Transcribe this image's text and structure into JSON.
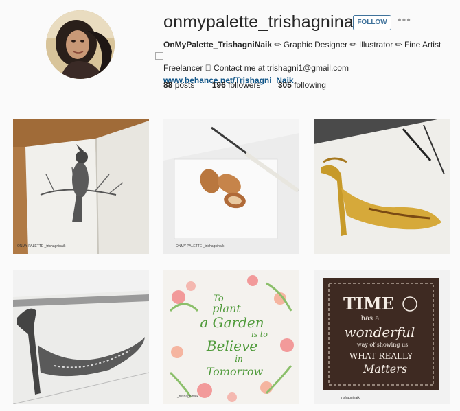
{
  "profile": {
    "username": "onmypalette_trishagninaik",
    "follow_label": "FOLLOW",
    "more_label": "•••",
    "bio_name": "OnMyPalette_TrishagniNaik",
    "bio_text_line1": " ✏ Graphic Designer ✏ Illustrator ✏ Fine Artist ⃞",
    "bio_text_line2": "Freelancer ⃞ Contact me at trishagni1@gmail.com",
    "website": "www.behance.net/Trishagni_Naik"
  },
  "stats": {
    "posts_count": "88",
    "posts_label": "posts",
    "followers_count": "196",
    "followers_label": "followers",
    "following_count": "305",
    "following_label": "following"
  },
  "posts": [
    {
      "subject": "bird-sketch",
      "watermark": "ONMY PALETTE _trishagninaik"
    },
    {
      "subject": "almonds-painting",
      "watermark": "ONMY PALETTE _trishagninaik"
    },
    {
      "subject": "gold-heel-painting"
    },
    {
      "subject": "heel-sketch"
    },
    {
      "subject": "floral-quote",
      "quote_lines": [
        "To",
        "plant",
        "a Garden",
        "is to",
        "Believe",
        "in",
        "Tomorrow"
      ],
      "watermark": "_trishagninaik"
    },
    {
      "subject": "lettering-art",
      "quote_lines": [
        "TIME",
        "has a",
        "wonderful",
        "way of showing us",
        "WHAT REALLY",
        "Matters"
      ],
      "watermark": "_trishagninaik"
    }
  ]
}
